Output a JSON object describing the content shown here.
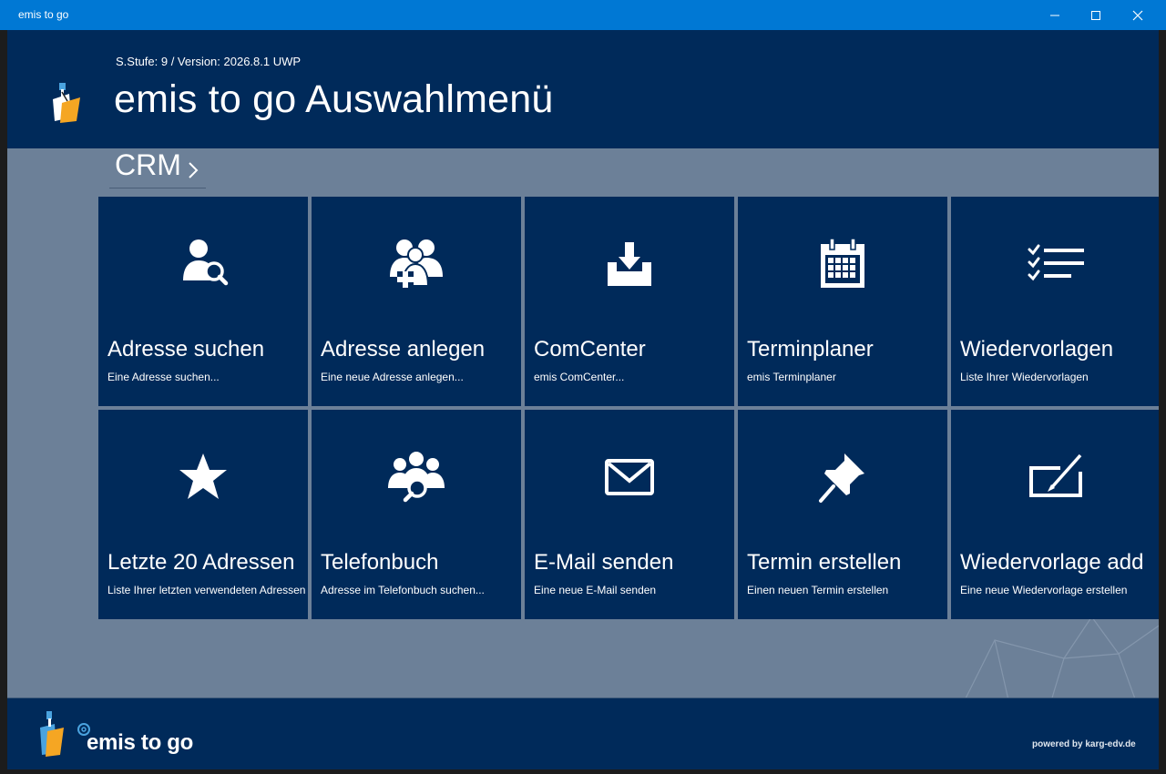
{
  "window": {
    "title": "emis to go"
  },
  "header": {
    "version": "S.Stufe: 9 / Version: 2026.8.1 UWP",
    "title": "emis to go Auswahlmenü"
  },
  "section": {
    "label": "CRM"
  },
  "tiles": [
    {
      "title": "Adresse suchen",
      "subtitle": "Eine Adresse suchen...",
      "icon": "user-search-icon"
    },
    {
      "title": "Adresse anlegen",
      "subtitle": "Eine neue Adresse anlegen...",
      "icon": "users-add-icon"
    },
    {
      "title": "ComCenter",
      "subtitle": "emis ComCenter...",
      "icon": "inbox-download-icon"
    },
    {
      "title": "Terminplaner",
      "subtitle": "emis Terminplaner",
      "icon": "calendar-icon"
    },
    {
      "title": "Wiedervorlagen",
      "subtitle": "Liste Ihrer Wiedervorlagen",
      "icon": "checklist-icon"
    },
    {
      "title": "Letzte 20 Adressen",
      "subtitle": "Liste Ihrer letzten verwendeten Adressen",
      "icon": "star-icon"
    },
    {
      "title": "Telefonbuch",
      "subtitle": "Adresse im Telefonbuch suchen...",
      "icon": "group-search-icon"
    },
    {
      "title": "E-Mail senden",
      "subtitle": "Eine neue E-Mail senden",
      "icon": "envelope-icon"
    },
    {
      "title": "Termin erstellen",
      "subtitle": "Einen neuen Termin erstellen",
      "icon": "pin-icon"
    },
    {
      "title": "Wiedervorlage add",
      "subtitle": "Eine neue Wiedervorlage erstellen",
      "icon": "edit-note-icon"
    }
  ],
  "footer": {
    "brand": "emis to go",
    "powered": "powered by karg-edv.de"
  },
  "colors": {
    "titlebar": "#0078d4",
    "header": "#002a5a",
    "content": "#6c8098",
    "tile": "#002a5a",
    "logo_orange": "#f5a623",
    "logo_blue": "#4aa3df"
  }
}
